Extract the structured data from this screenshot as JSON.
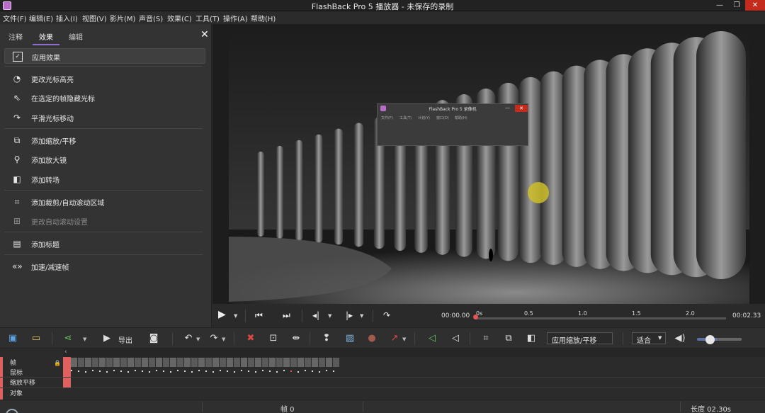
{
  "window": {
    "title": "FlashBack Pro 5 播放器 - 未保存的录制",
    "min": "—",
    "max": "❐",
    "close": "✕"
  },
  "menu": [
    "文件(F)",
    "编辑(E)",
    "插入(I)",
    "视图(V)",
    "影片(M)",
    "声音(S)",
    "效果(C)",
    "工具(T)",
    "操作(A)",
    "帮助(H)"
  ],
  "panel": {
    "tabs": [
      "注释",
      "效果",
      "编辑"
    ],
    "active_tab": "效果",
    "close": "✕",
    "effects": [
      {
        "label": "应用效果",
        "icon": "checkbox-icon"
      },
      {
        "label": "更改光标高亮",
        "icon": "cursor-highlight-icon"
      },
      {
        "label": "在选定的帧隐藏光标",
        "icon": "cursor-icon"
      },
      {
        "label": "平滑光标移动",
        "icon": "curve-icon"
      },
      {
        "label": "添加缩放/平移",
        "icon": "zoom-pan-icon"
      },
      {
        "label": "添加放大镜",
        "icon": "magnifier-icon"
      },
      {
        "label": "添加转场",
        "icon": "transition-icon"
      },
      {
        "label": "添加裁剪/自动滚动区域",
        "icon": "crop-icon"
      },
      {
        "label": "更改自动滚动设置",
        "icon": "autoscroll-icon"
      },
      {
        "label": "添加标题",
        "icon": "caption-icon"
      },
      {
        "label": "加速/减速帧",
        "icon": "speed-icon"
      }
    ]
  },
  "recorder": {
    "title": "FlashBack Pro 5 录像机",
    "min": "—",
    "close": "✕",
    "menu": [
      "文件(F)",
      "工具(T)",
      "计划(Y)",
      "窗口(D)",
      "帮助(H)"
    ]
  },
  "playback": {
    "current_time": "00:00.00",
    "total_time": "00:02.33",
    "ticks": [
      "0s",
      "0.5",
      "1.0",
      "1.5",
      "2.0"
    ],
    "progress": 0
  },
  "toolbar": {
    "export_label": "导出",
    "effect_field": "应用缩放/平移",
    "fit_select": "适合",
    "volume": 0.3
  },
  "timeline": {
    "tracks": [
      "帧",
      "鼠标",
      "缩放平移",
      "对象"
    ],
    "frame_count": 38,
    "mouse_points": 38
  },
  "status": {
    "frame": "帧 0",
    "length": "长度 02.30s"
  }
}
